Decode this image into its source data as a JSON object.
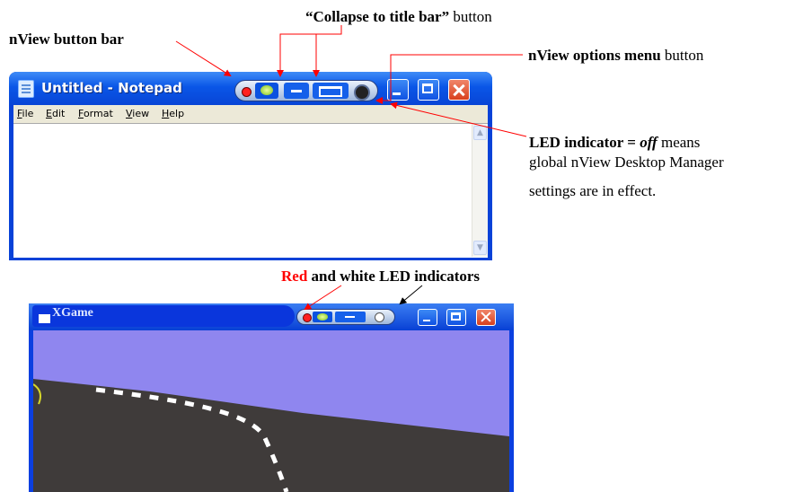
{
  "annotations": {
    "collapse_bold": "“Collapse to title bar”",
    "collapse_rest": " button",
    "button_bar": "nView button bar",
    "options_bold": "nView options menu",
    "options_rest": " button",
    "led_bold": "LED indicator = ",
    "led_off": "off",
    "led_rest": " means",
    "led_line2": "global nView Desktop Manager",
    "led_line3": "settings are in effect.",
    "red_word": "Red",
    "red_rest": " and white LED indicators"
  },
  "notepad": {
    "title": "Untitled - Notepad",
    "menu": [
      "File",
      "Edit",
      "Format",
      "View",
      "Help"
    ],
    "scroll_up": "▲",
    "scroll_down": "▼"
  },
  "xgame": {
    "title": "XGame"
  },
  "colors": {
    "xp_titlebar": "#0842d8",
    "annotation_red": "#ff0000",
    "sky": "#8f86ef",
    "road": "#3f3b3a",
    "led_red": "#ff2020",
    "led_white": "#ffffff"
  },
  "icons": [
    "notepad-icon",
    "nvidia-logo-icon",
    "collapse-icon",
    "options-menu-icon",
    "minimize-icon",
    "maximize-icon",
    "close-icon",
    "led-red-icon",
    "led-white-icon"
  ]
}
